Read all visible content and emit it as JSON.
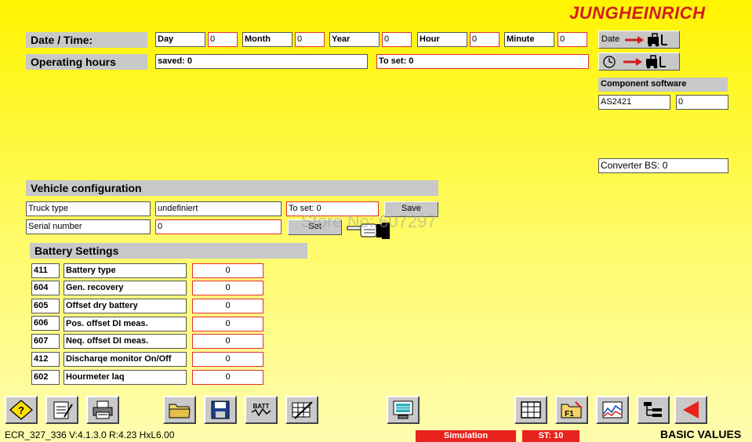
{
  "brand": {
    "logo_text": "JUNGHEINRICH",
    "color": "#d01e1e"
  },
  "datetime": {
    "label": "Date / Time:",
    "fields": [
      {
        "label": "Day",
        "value": "0"
      },
      {
        "label": "Month",
        "value": "0"
      },
      {
        "label": "Year",
        "value": "0"
      },
      {
        "label": "Hour",
        "value": "0"
      },
      {
        "label": "Minute",
        "value": "0"
      }
    ],
    "date_button_label": "Date"
  },
  "operating_hours": {
    "label": "Operating hours",
    "saved": "saved: 0",
    "to_set": "To set: 0"
  },
  "component_software": {
    "label": "Component software",
    "name": "AS2421",
    "value": "0"
  },
  "converter": {
    "text": "Converter BS: 0"
  },
  "vehicle": {
    "label": "Vehicle configuration",
    "truck_type_label": "Truck type",
    "truck_type_value": "undefiniert",
    "to_set": "To set: 0",
    "save_label": "Save",
    "serial_label": "Serial number",
    "serial_value": "0",
    "set_label": "Set"
  },
  "battery": {
    "label": "Battery Settings",
    "rows": [
      {
        "code": "411",
        "name": "Battery type",
        "value": "0"
      },
      {
        "code": "604",
        "name": "Gen. recovery",
        "value": "0"
      },
      {
        "code": "605",
        "name": "Offset dry battery",
        "value": "0"
      },
      {
        "code": "606",
        "name": "Pos. offset DI meas.",
        "value": "0"
      },
      {
        "code": "607",
        "name": "Neq. offset DI meas.",
        "value": "0"
      },
      {
        "code": "412",
        "name": "Discharqe monitor On/Off",
        "value": "0"
      },
      {
        "code": "602",
        "name": "Hourmeter laq",
        "value": "0"
      }
    ]
  },
  "watermark": "Store No: 607297",
  "status": {
    "version": "ECR_327_336 V:4.1.3.0 R:4.23 HxL6.00",
    "simulation": "Simulation",
    "st": "ST: 10",
    "page_title": "BASIC VALUES",
    "status_color": "#e8221c"
  },
  "toolbar_icons": [
    "help-icon",
    "notepad-icon",
    "printer-icon",
    "folder-icon",
    "save-disk-icon",
    "battery-signal-icon",
    "edit-grid-icon",
    "monitor-icon",
    "table-icon",
    "f1-folder-icon",
    "chart-icon",
    "tree-icon",
    "back-arrow-icon"
  ]
}
